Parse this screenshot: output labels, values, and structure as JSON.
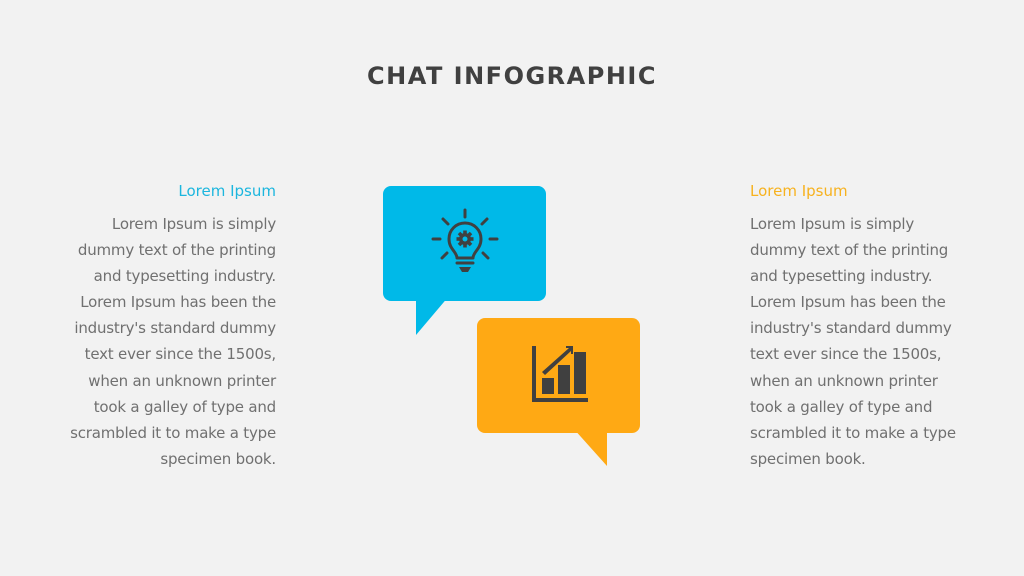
{
  "title": "CHAT INFOGRAPHIC",
  "colors": {
    "blue": "#00b9e8",
    "orange": "#ffa914",
    "icon": "#404040",
    "body_text": "#707070",
    "title_text": "#404040",
    "background": "#f2f2f2"
  },
  "left_block": {
    "heading": "Lorem Ipsum",
    "heading_color": "#1cb6de",
    "lines": [
      "Lorem Ipsum is simply",
      "dummy text of the printing",
      "and typesetting industry.",
      "Lorem Ipsum has been the",
      "industry's standard dummy",
      "text ever since the 1500s,",
      "when an unknown printer",
      "took a galley of type and",
      "scrambled it to make a type",
      "specimen book."
    ]
  },
  "right_block": {
    "heading": "Lorem Ipsum",
    "heading_color": "#f7b21f",
    "lines": [
      "Lorem Ipsum is simply",
      "dummy text of the printing",
      "and typesetting industry.",
      "Lorem Ipsum has been the",
      "industry's standard dummy",
      "text ever since the 1500s,",
      "when an unknown printer",
      "took a galley of type and",
      "scrambled it to make a type",
      "specimen book."
    ]
  },
  "bubbles": [
    {
      "name": "idea",
      "icon": "lightbulb-gear-icon",
      "color": "#00b9e8"
    },
    {
      "name": "growth",
      "icon": "bar-chart-growth-icon",
      "color": "#ffa914"
    }
  ]
}
